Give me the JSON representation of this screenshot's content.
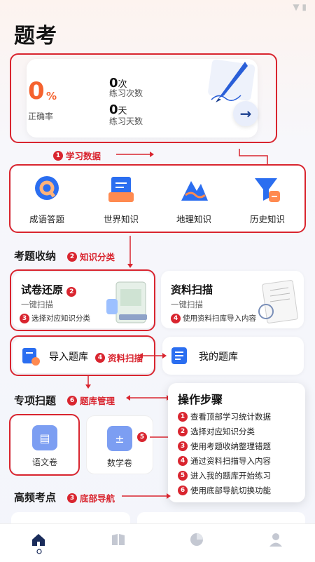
{
  "page_title": "题考",
  "stats": {
    "accuracy_value": "0",
    "accuracy_unit": "%",
    "accuracy_label": "正确率",
    "practice_count_value": "0",
    "practice_count_unit": "次",
    "practice_count_label": "练习次数",
    "practice_days_value": "0",
    "practice_days_unit": "天",
    "practice_days_label": "练习天数",
    "arrow": "→"
  },
  "annotations": {
    "a1": {
      "num": "1",
      "text": "学习数据"
    },
    "a2": {
      "num": "2",
      "text": "知识分类"
    },
    "a3": {
      "num": "3",
      "text": "底部导航"
    },
    "a4": {
      "num": "4",
      "text": "资料扫描"
    },
    "a5": {
      "num": "5"
    },
    "a6": {
      "num": "6",
      "text": "题库管理"
    }
  },
  "categories": [
    {
      "label": "成语答题",
      "icon": "q-bubble-icon"
    },
    {
      "label": "世界知识",
      "icon": "document-stack-icon"
    },
    {
      "label": "地理知识",
      "icon": "mountain-icon"
    },
    {
      "label": "历史知识",
      "icon": "funnel-icon"
    }
  ],
  "sections": {
    "collect": "考题收纳",
    "special": "专项扫题",
    "frequent": "高频考点"
  },
  "tiles": {
    "restore": {
      "title": "试卷还原",
      "title_num": "2",
      "sub": "一键扫描",
      "note_num": "3",
      "note": "选择对应知识分类"
    },
    "scan": {
      "title": "资料扫描",
      "sub": "一键扫描",
      "note_num": "4",
      "note": "使用资料扫库导入内容"
    },
    "import": {
      "title": "导入题库"
    },
    "mybank": {
      "title": "我的题库"
    }
  },
  "special_items": [
    {
      "label": "语文卷",
      "icon": "book-icon"
    },
    {
      "label": "数学卷",
      "icon": "calculator-icon"
    }
  ],
  "steps": {
    "title": "操作步骤",
    "items": [
      {
        "num": "1",
        "text": "查看顶部学习统计数据"
      },
      {
        "num": "2",
        "text": "选择对应知识分类"
      },
      {
        "num": "3",
        "text": "使用考题收纳整理错题"
      },
      {
        "num": "4",
        "text": "通过资料扫描导入内容"
      },
      {
        "num": "5",
        "text": "进入我的题库开始练习"
      },
      {
        "num": "6",
        "text": "使用底部导航切换功能"
      }
    ]
  },
  "nav": [
    "home-icon",
    "book-open-icon",
    "chart-pie-icon",
    "user-icon"
  ],
  "colors": {
    "accent": "#f5622e",
    "annotation": "#d9252f",
    "primary": "#2b6ef0"
  }
}
